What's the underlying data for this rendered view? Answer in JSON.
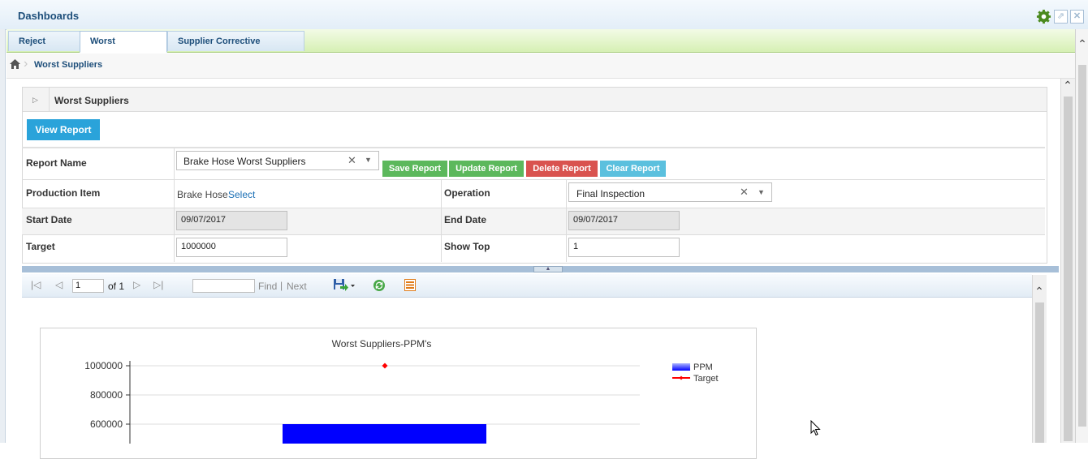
{
  "window": {
    "title": "Dashboards"
  },
  "tabs": [
    {
      "label": "Reject Ratio",
      "active": false
    },
    {
      "label": "Worst Suppliers",
      "active": true
    },
    {
      "label": "Supplier Corrective Actions",
      "active": false
    }
  ],
  "breadcrumb": {
    "current": "Worst Suppliers"
  },
  "panel": {
    "title": "Worst Suppliers"
  },
  "actions": {
    "view_report": "View Report",
    "save_report": "Save Report",
    "update_report": "Update Report",
    "delete_report": "Delete Report",
    "clear_report": "Clear Report"
  },
  "form": {
    "report_name_label": "Report Name",
    "report_name_value": "Brake Hose Worst Suppliers",
    "production_item_label": "Production Item",
    "production_item_value": "Brake Hose",
    "production_item_link": "Select",
    "operation_label": "Operation",
    "operation_value": "Final Inspection",
    "start_date_label": "Start Date",
    "start_date_value": "09/07/2017",
    "end_date_label": "End Date",
    "end_date_value": "09/07/2017",
    "target_label": "Target",
    "target_value": "1000000",
    "show_top_label": "Show Top",
    "show_top_value": "1"
  },
  "report_toolbar": {
    "page_value": "1",
    "of_text": "of 1",
    "find_value": "",
    "find_label": "Find",
    "separator": "|",
    "next_label": "Next"
  },
  "colors": {
    "save": "#5cb85c",
    "update": "#5cb85c",
    "delete": "#d9534f",
    "clear": "#5bc0de",
    "view": "#2aa3da",
    "ppm_bar": "#0000ff",
    "target_line": "#ff0000"
  },
  "chart_data": {
    "type": "bar",
    "title": "Worst Suppliers-PPM's",
    "yticks": [
      "1000000",
      "800000",
      "600000"
    ],
    "ylim": [
      0,
      1000000
    ],
    "series": [
      {
        "name": "PPM",
        "values": [
          600000
        ]
      },
      {
        "name": "Target",
        "values": [
          1000000
        ]
      }
    ],
    "legend_position": "top-right"
  }
}
